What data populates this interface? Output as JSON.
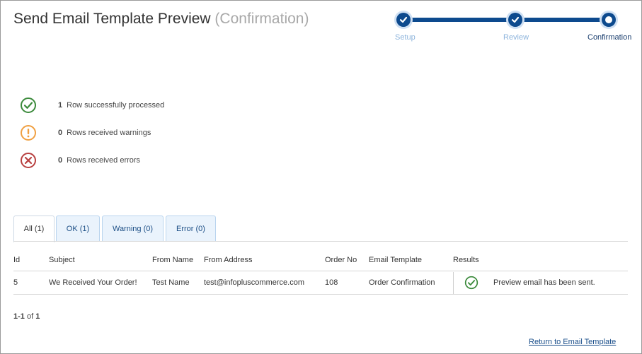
{
  "page": {
    "title": "Send Email Template Preview",
    "subtitle": "(Confirmation)"
  },
  "stepper": {
    "steps": [
      {
        "label": "Setup",
        "state": "done"
      },
      {
        "label": "Review",
        "state": "done"
      },
      {
        "label": "Confirmation",
        "state": "current"
      }
    ]
  },
  "summary": [
    {
      "count": "1",
      "text": "Row successfully processed",
      "icon": "success-check-icon",
      "color": "#3b8a3b"
    },
    {
      "count": "0",
      "text": "Rows received warnings",
      "icon": "warning-exclamation-icon",
      "color": "#f0a042"
    },
    {
      "count": "0",
      "text": "Rows received errors",
      "icon": "error-x-icon",
      "color": "#b84040"
    }
  ],
  "tabs": [
    {
      "label": "All (1)",
      "active": true
    },
    {
      "label": "OK (1)",
      "active": false
    },
    {
      "label": "Warning (0)",
      "active": false
    },
    {
      "label": "Error (0)",
      "active": false
    }
  ],
  "table": {
    "headers": [
      "Id",
      "Subject",
      "From Name",
      "From Address",
      "Order No",
      "Email Template",
      "Results"
    ],
    "rows": [
      {
        "id": "5",
        "subject": "We Received Your Order!",
        "from_name": "Test Name",
        "from_address": "test@infopluscommerce.com",
        "order_no": "108",
        "email_template": "Order Confirmation",
        "result_icon": "success-check-icon",
        "result_text": "Preview email has been sent."
      }
    ]
  },
  "pager": {
    "range": "1-1",
    "of_label": "of",
    "total": "1"
  },
  "footer": {
    "return_link": "Return to Email Template"
  },
  "colors": {
    "accent": "#0d4a8e",
    "success": "#3b8a3b",
    "warning": "#f0a042",
    "error": "#b84040",
    "link": "#1a4e8a"
  }
}
